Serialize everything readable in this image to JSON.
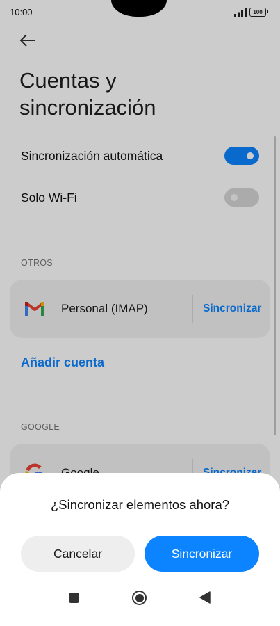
{
  "status": {
    "time": "10:00",
    "battery": "100"
  },
  "page": {
    "title": "Cuentas y sincronización"
  },
  "settings": {
    "auto_sync": {
      "label": "Sincronización automática",
      "enabled": true
    },
    "wifi_only": {
      "label": "Solo Wi-Fi",
      "enabled": false
    }
  },
  "sections": {
    "others": {
      "header": "OTROS",
      "account": {
        "name": "Personal (IMAP)",
        "icon": "gmail-icon",
        "action": "Sincronizar"
      }
    },
    "add_account": "Añadir cuenta",
    "google": {
      "header": "GOOGLE",
      "account": {
        "name": "Google",
        "icon": "google-g-icon",
        "action": "Sincronizar"
      }
    }
  },
  "dialog": {
    "question": "¿Sincronizar elementos ahora?",
    "cancel_label": "Cancelar",
    "confirm_label": "Sincronizar"
  },
  "navbar": {
    "icons": [
      "recents-icon",
      "home-icon",
      "back-triangle-icon"
    ]
  },
  "colors": {
    "accent": "#0d84ff",
    "toggle_off": "#d6d6d6",
    "card": "#f2f2f2"
  }
}
